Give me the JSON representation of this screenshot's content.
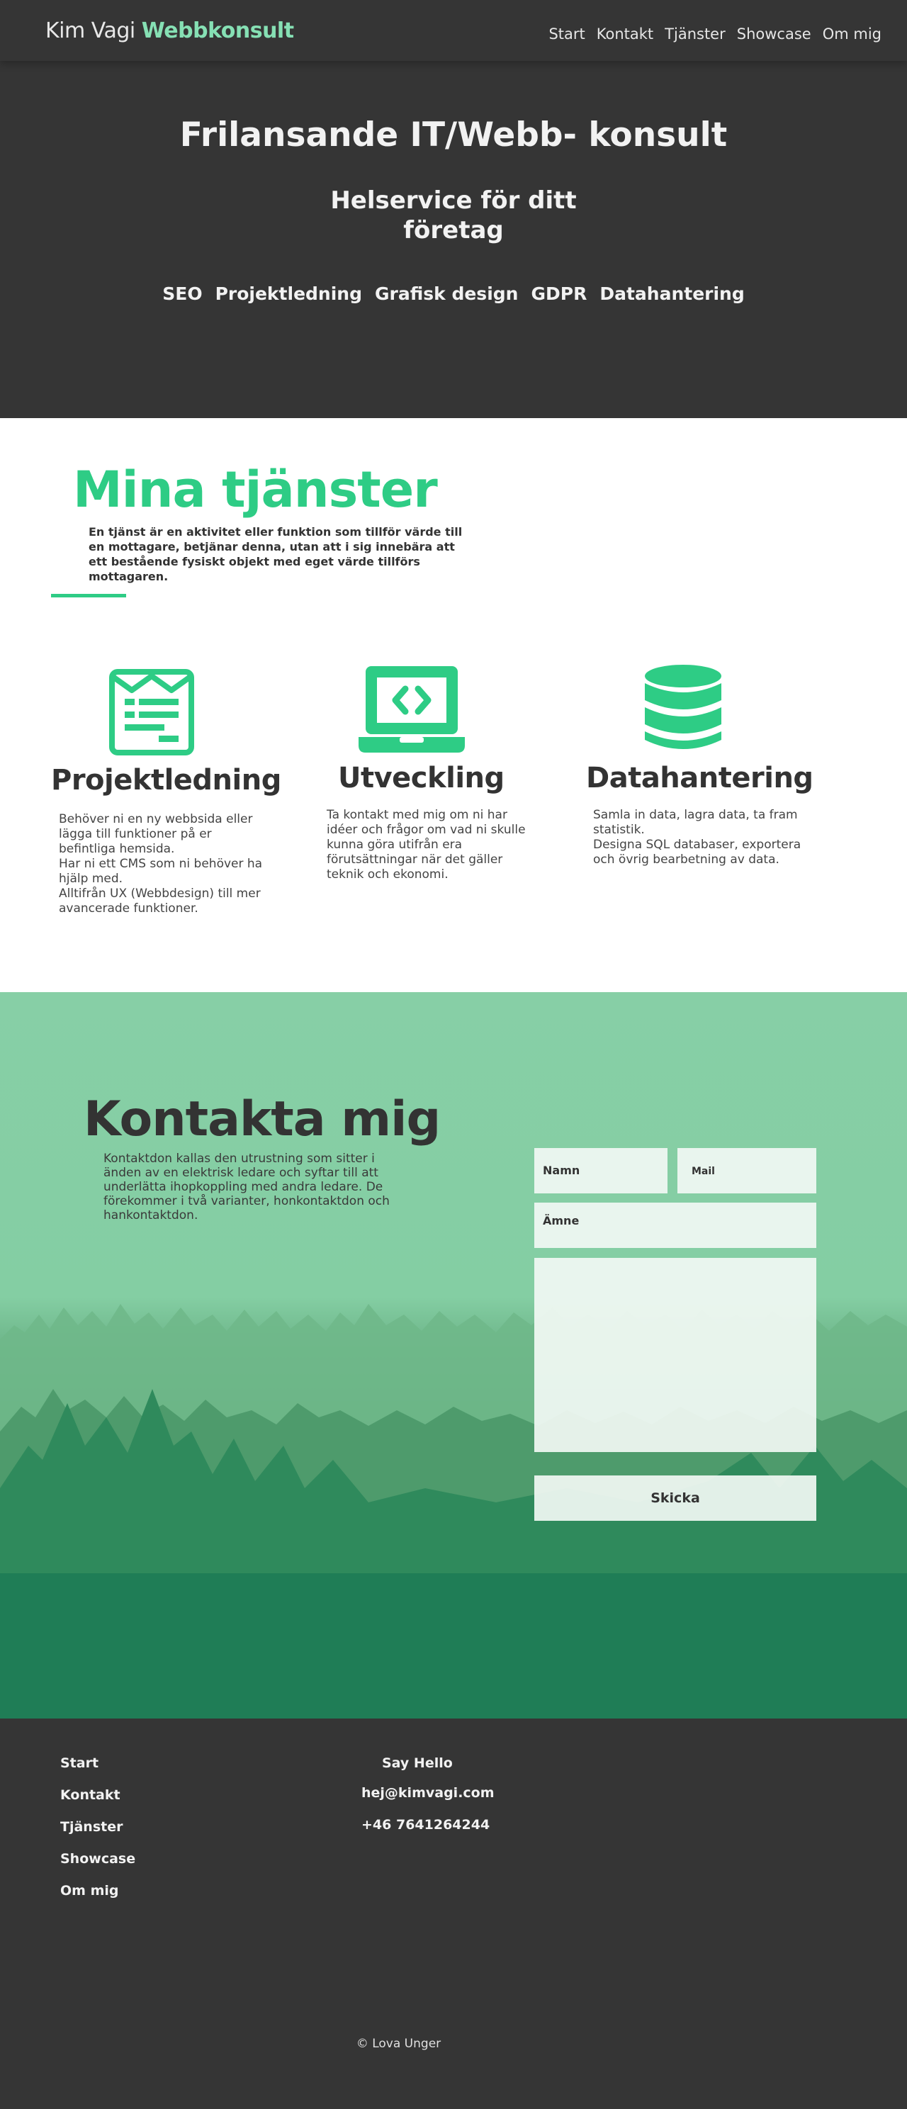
{
  "nav": {
    "brand_name": "Kim Vagi",
    "brand_accent": "Webbkonsult",
    "links": [
      "Start",
      "Kontakt",
      "Tjänster",
      "Showcase",
      "Om mig"
    ]
  },
  "hero": {
    "title": "Frilansande IT/Webb- konsult",
    "subtitle": "Helservice för ditt företag",
    "tags": [
      "SEO",
      "Projektledning",
      "Grafisk design",
      "GDPR",
      "Datahantering"
    ]
  },
  "services": {
    "title": "Mina tjänster",
    "intro": "En tjänst är en aktivitet eller funktion som tillför värde till en mottagare, betjänar denna, utan att i sig innebära att ett bestående fysiskt objekt med eget värde tillförs mottagaren.",
    "items": [
      {
        "icon": "newspaper-icon",
        "name": "Projektledning",
        "description": "Behöver ni en ny webbsida eller lägga till funktioner på er befintliga hemsida.\nHar ni ett CMS som ni behöver ha hjälp med.\nAlltifrån UX (Webbdesign) till mer avancerade funktioner."
      },
      {
        "icon": "laptop-code-icon",
        "name": "Utveckling",
        "description": "Ta kontakt med mig om ni har idéer och frågor om vad ni skulle kunna göra utifrån era förutsättningar när det gäller teknik och ekonomi."
      },
      {
        "icon": "database-icon",
        "name": "Datahantering",
        "description": "Samla in data, lagra data, ta fram statistik.\nDesigna SQL databaser, exportera och övrig bearbetning av data."
      }
    ]
  },
  "contact": {
    "title": "Kontakta mig",
    "text": "Kontaktdon kallas den utrustning som sitter i änden av en elektrisk ledare och syftar till att underlätta ihopkoppling med andra ledare. De förekommer i två varianter, honkontaktdon och hankontaktdon.",
    "name_placeholder": "Namn",
    "mail_placeholder": "Mail",
    "subject_placeholder": "Ämne",
    "message_value": "",
    "send_label": "Skicka"
  },
  "footer": {
    "links": [
      "Start",
      "Kontakt",
      "Tjänster",
      "Showcase",
      "Om mig"
    ],
    "say_hello": "Say Hello",
    "email": "hej@kimvagi.com",
    "phone": "+46 7641264244",
    "copyright": "© Lova Unger"
  },
  "colors": {
    "accent": "#2ecc85",
    "brand_accent": "#86e0b4",
    "dark": "#353535"
  }
}
